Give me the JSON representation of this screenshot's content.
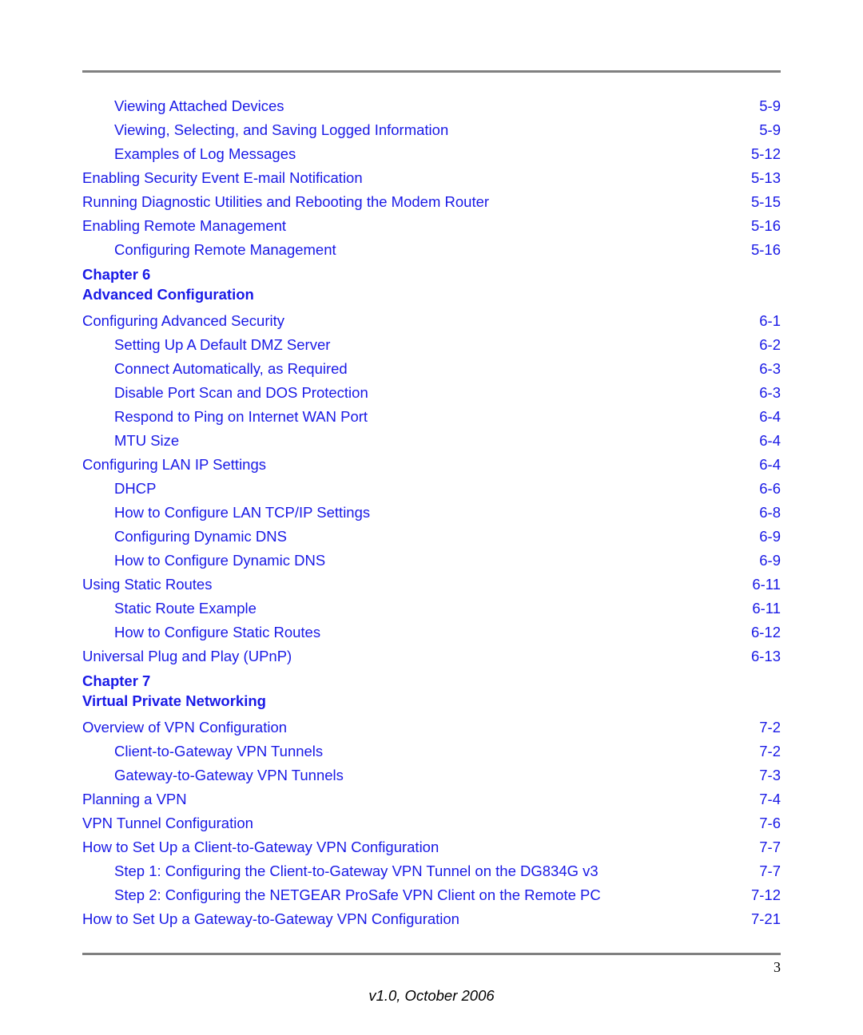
{
  "document": {
    "page_number": "3",
    "version_footer": "v1.0, October 2006"
  },
  "toc": {
    "blocks": [
      {
        "type": "entries",
        "entries": [
          {
            "level": 1,
            "title": "Viewing Attached Devices",
            "page": "5-9"
          },
          {
            "level": 1,
            "title": "Viewing, Selecting, and Saving Logged Information",
            "page": "5-9"
          },
          {
            "level": 1,
            "title": "Examples of Log Messages",
            "page": "5-12"
          },
          {
            "level": 0,
            "title": "Enabling Security Event E-mail Notification",
            "page": "5-13"
          },
          {
            "level": 0,
            "title": "Running Diagnostic Utilities and Rebooting the Modem Router",
            "page": "5-15"
          },
          {
            "level": 0,
            "title": "Enabling Remote Management",
            "page": "5-16"
          },
          {
            "level": 1,
            "title": "Configuring Remote Management",
            "page": "5-16"
          }
        ]
      },
      {
        "type": "chapter",
        "chapter_label": "Chapter 6",
        "chapter_title": "Advanced Configuration"
      },
      {
        "type": "entries",
        "entries": [
          {
            "level": 0,
            "title": "Configuring Advanced Security",
            "page": "6-1"
          },
          {
            "level": 1,
            "title": "Setting Up A Default DMZ Server",
            "page": "6-2"
          },
          {
            "level": 1,
            "title": "Connect Automatically, as Required",
            "page": "6-3"
          },
          {
            "level": 1,
            "title": "Disable Port Scan and DOS Protection",
            "page": "6-3"
          },
          {
            "level": 1,
            "title": "Respond to Ping on Internet WAN Port",
            "page": "6-4"
          },
          {
            "level": 1,
            "title": "MTU Size",
            "page": "6-4"
          },
          {
            "level": 0,
            "title": "Configuring LAN IP Settings",
            "page": "6-4"
          },
          {
            "level": 1,
            "title": "DHCP",
            "page": "6-6"
          },
          {
            "level": 1,
            "title": "How to Configure LAN TCP/IP Settings",
            "page": "6-8"
          },
          {
            "level": 1,
            "title": "Configuring Dynamic DNS",
            "page": "6-9"
          },
          {
            "level": 1,
            "title": "How to Configure Dynamic DNS",
            "page": "6-9"
          },
          {
            "level": 0,
            "title": "Using Static Routes",
            "page": "6-11"
          },
          {
            "level": 1,
            "title": "Static Route Example",
            "page": "6-11"
          },
          {
            "level": 1,
            "title": "How to Configure Static Routes",
            "page": "6-12"
          },
          {
            "level": 0,
            "title": "Universal Plug and Play (UPnP)",
            "page": "6-13"
          }
        ]
      },
      {
        "type": "chapter",
        "chapter_label": "Chapter 7",
        "chapter_title": "Virtual Private Networking"
      },
      {
        "type": "entries",
        "entries": [
          {
            "level": 0,
            "title": "Overview of VPN Configuration",
            "page": "7-2"
          },
          {
            "level": 1,
            "title": "Client-to-Gateway VPN Tunnels",
            "page": "7-2"
          },
          {
            "level": 1,
            "title": "Gateway-to-Gateway VPN Tunnels",
            "page": "7-3"
          },
          {
            "level": 0,
            "title": "Planning a VPN",
            "page": "7-4"
          },
          {
            "level": 0,
            "title": "VPN Tunnel Configuration",
            "page": "7-6"
          },
          {
            "level": 0,
            "title": "How to Set Up a Client-to-Gateway VPN Configuration",
            "page": "7-7"
          },
          {
            "level": 1,
            "title": "Step 1: Configuring the Client-to-Gateway VPN Tunnel on the DG834G v3",
            "page": "7-7"
          },
          {
            "level": 1,
            "title": "Step 2: Configuring the NETGEAR ProSafe VPN Client on the Remote PC",
            "page": "7-12"
          },
          {
            "level": 0,
            "title": "How to Set Up a Gateway-to-Gateway VPN Configuration",
            "page": "7-21"
          }
        ]
      }
    ]
  },
  "colors": {
    "link_blue": "#1a1ae6",
    "rule_gray": "#808080",
    "footer_text": "#000000"
  }
}
